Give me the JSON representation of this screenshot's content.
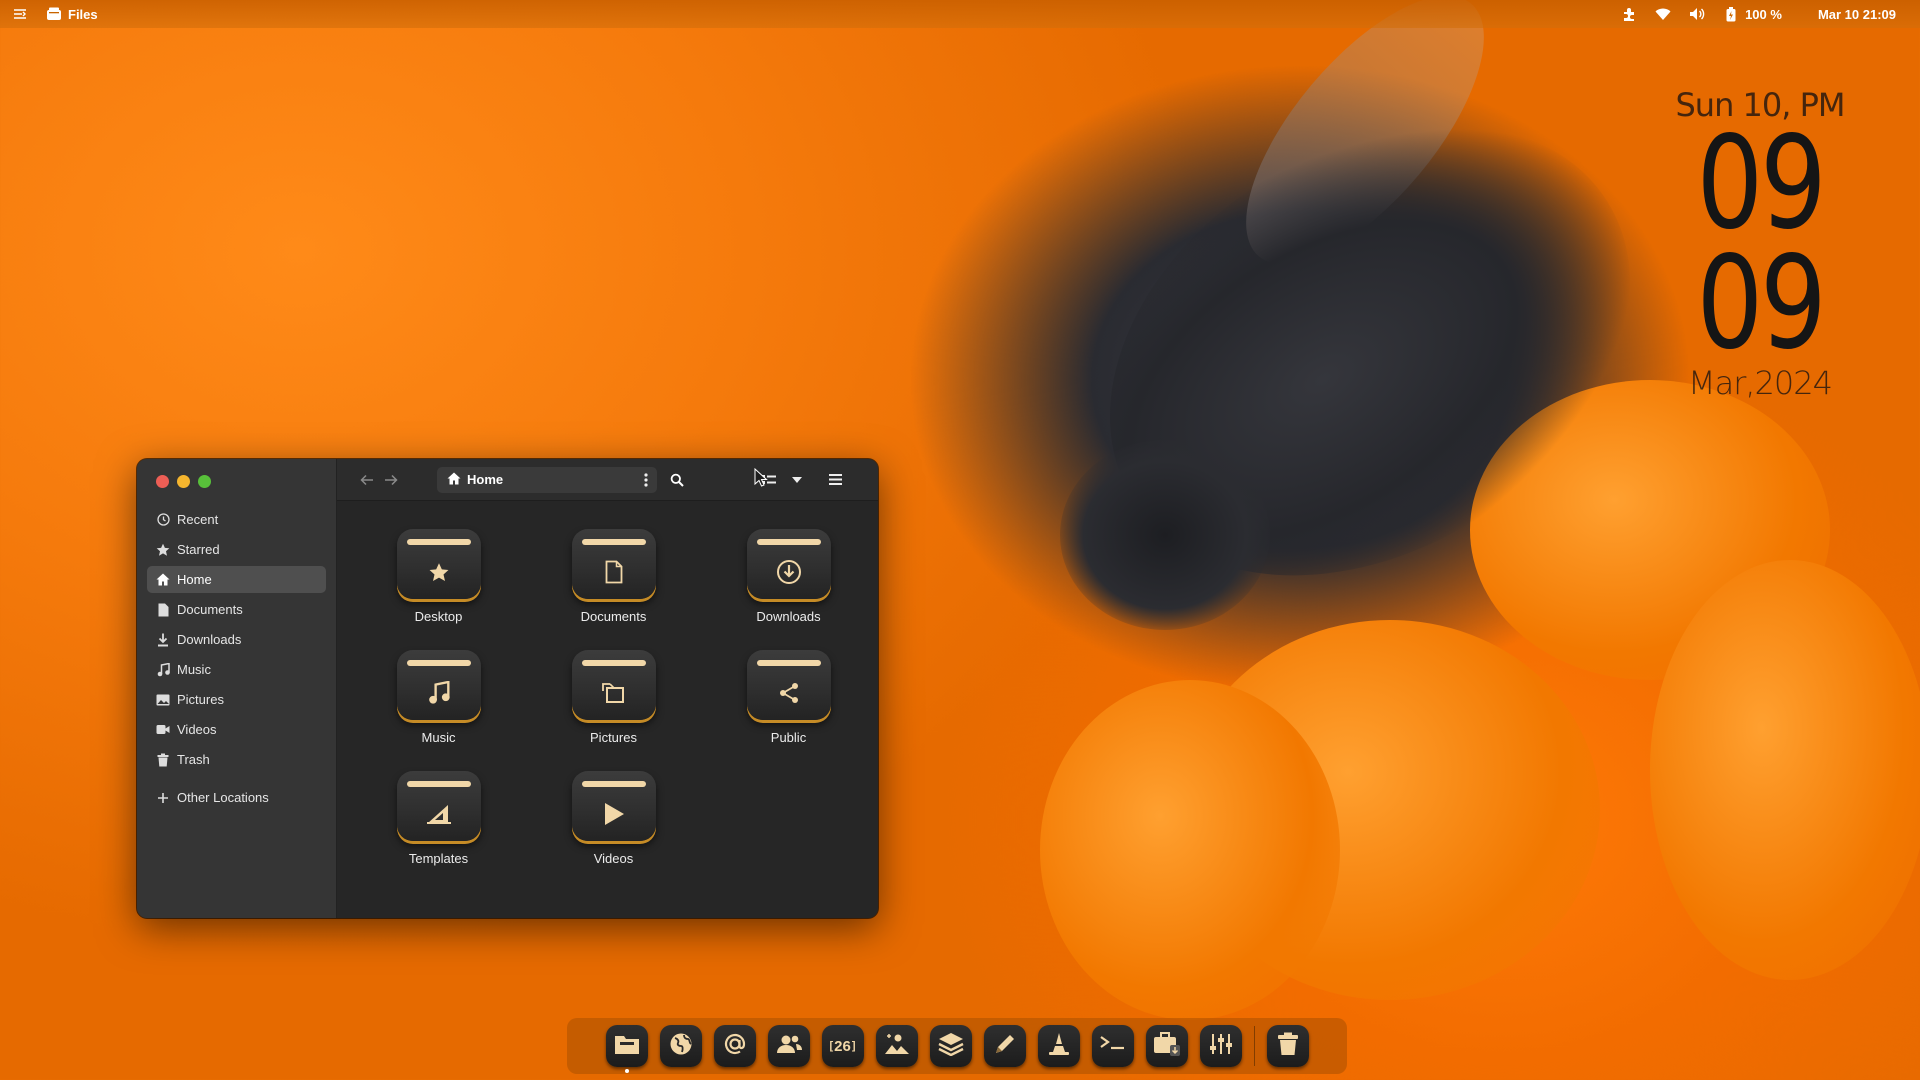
{
  "topbar": {
    "app_name": "Files",
    "battery": "100 %",
    "clock": "Mar 10  21:09",
    "icons": [
      "activities-icon",
      "files-app-icon",
      "extension-icon",
      "wifi-icon",
      "volume-icon",
      "battery-icon"
    ]
  },
  "desktop_clock": {
    "day": "Sun 10, PM",
    "hour": "09",
    "minute": "09",
    "date": "Mar,2024"
  },
  "window": {
    "sidebar": {
      "items": [
        {
          "label": "Recent",
          "icon": "clock-icon"
        },
        {
          "label": "Starred",
          "icon": "star-icon"
        },
        {
          "label": "Home",
          "icon": "home-icon",
          "active": true
        },
        {
          "label": "Documents",
          "icon": "document-icon"
        },
        {
          "label": "Downloads",
          "icon": "download-icon"
        },
        {
          "label": "Music",
          "icon": "music-icon"
        },
        {
          "label": "Pictures",
          "icon": "picture-icon"
        },
        {
          "label": "Videos",
          "icon": "video-icon"
        },
        {
          "label": "Trash",
          "icon": "trash-icon"
        }
      ],
      "other": {
        "label": "Other Locations",
        "icon": "plus-icon"
      }
    },
    "path": "Home",
    "folders": [
      {
        "label": "Desktop",
        "icon": "star-icon"
      },
      {
        "label": "Documents",
        "icon": "document-icon"
      },
      {
        "label": "Downloads",
        "icon": "download-icon"
      },
      {
        "label": "Music",
        "icon": "music-icon"
      },
      {
        "label": "Pictures",
        "icon": "picture-icon"
      },
      {
        "label": "Public",
        "icon": "share-icon"
      },
      {
        "label": "Templates",
        "icon": "template-icon"
      },
      {
        "label": "Videos",
        "icon": "play-icon"
      }
    ]
  },
  "dock": {
    "calendar_text": "26",
    "items": [
      "files",
      "browser",
      "mail",
      "contacts",
      "calendar",
      "photos",
      "software-center",
      "text-editor",
      "media-player",
      "terminal",
      "installer",
      "settings",
      "trash"
    ]
  },
  "colors": {
    "accent": "#f1d7a8",
    "window_bg": "#262626",
    "sidebar_bg": "#353535",
    "close": "#ed5e55",
    "minimize": "#f5b52e",
    "maximize": "#58c03a"
  }
}
